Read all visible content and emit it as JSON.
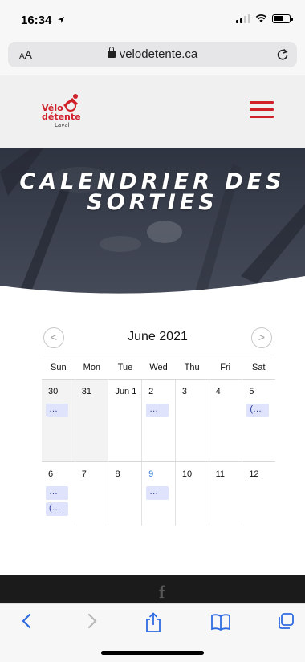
{
  "status": {
    "time": "16:34"
  },
  "browser": {
    "aa_label_small": "A",
    "aa_label_large": "A",
    "url": "velodetente.ca"
  },
  "site": {
    "logo_text_top": "Vélo",
    "logo_text_mid": "détente",
    "logo_text_bottom": "Laval",
    "brand_color": "#d0202a"
  },
  "hero": {
    "title_line1": "CALENDRIER DES",
    "title_line2": "SORTIES"
  },
  "calendar": {
    "title": "June 2021",
    "prev_label": "<",
    "next_label": ">",
    "weekdays": [
      "Sun",
      "Mon",
      "Tue",
      "Wed",
      "Thu",
      "Fri",
      "Sat"
    ],
    "weeks": [
      [
        {
          "num": "30",
          "events": [
            "…"
          ],
          "other": true
        },
        {
          "num": "31",
          "events": [],
          "other": true
        },
        {
          "num": "Jun 1",
          "events": []
        },
        {
          "num": "2",
          "events": [
            "…"
          ]
        },
        {
          "num": "3",
          "events": []
        },
        {
          "num": "4",
          "events": []
        },
        {
          "num": "5",
          "events": [
            "(…"
          ]
        }
      ],
      [
        {
          "num": "6",
          "events": [
            "…",
            "(…"
          ]
        },
        {
          "num": "7",
          "events": []
        },
        {
          "num": "8",
          "events": []
        },
        {
          "num": "9",
          "events": [
            "…"
          ],
          "today": true
        },
        {
          "num": "10",
          "events": []
        },
        {
          "num": "11",
          "events": []
        },
        {
          "num": "12",
          "events": []
        }
      ]
    ]
  },
  "footer": {
    "facebook_glyph": "f"
  },
  "toolbar": {
    "back": "<",
    "forward": ">"
  }
}
